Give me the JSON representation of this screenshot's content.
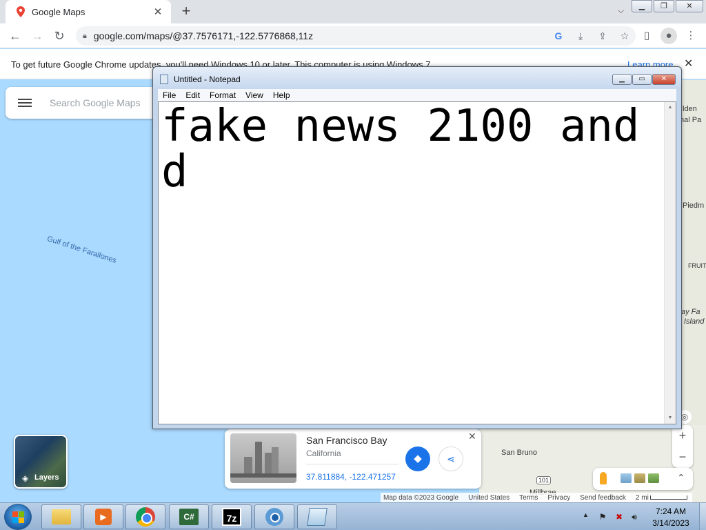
{
  "browser": {
    "tab_title": "Google Maps",
    "tab_close": "✕",
    "new_tab": "+",
    "url": "google.com/maps/@37.7576171,-122.5776868,11z",
    "infobar_message": "To get future Google Chrome updates, you'll need Windows 10 or later. This computer is using Windows 7.",
    "infobar_link": "Learn more",
    "infobar_close": "✕"
  },
  "maps": {
    "search_placeholder": "Search Google Maps",
    "gulf_label": "Gulf of the Farallones",
    "layers_label": "Layers",
    "right_labels": [
      "lden",
      "nal Pa",
      "Piedm",
      "FRUIT",
      "ay Fa",
      "Island"
    ],
    "san_bruno": "San Bruno",
    "millbrae": "Millbrae",
    "highway": "101",
    "place_card": {
      "name": "San Francisco Bay",
      "region": "California",
      "coords": "37.811884, -122.471257",
      "close": "✕"
    },
    "zoom_in": "+",
    "zoom_out": "−",
    "attribution": {
      "map_data": "Map data ©2023 Google",
      "country": "United States",
      "terms": "Terms",
      "privacy": "Privacy",
      "feedback": "Send feedback",
      "scale": "2 mi"
    }
  },
  "notepad": {
    "title": "Untitled - Notepad",
    "menus": [
      "File",
      "Edit",
      "Format",
      "View",
      "Help"
    ],
    "content": "fake news 2100 and d"
  },
  "taskbar": {
    "media_glyph": "▶",
    "cs_label": "C#",
    "sevenzip_label": "7z",
    "time": "7:24 AM",
    "date": "3/14/2023"
  },
  "colors": {
    "water": "#aadaff",
    "link": "#1a73e8",
    "notepad_frame": "#c4d6ec",
    "taskbar": "#95b3d4"
  },
  "icons": [
    "google-maps-favicon",
    "back-arrow-icon",
    "forward-arrow-icon",
    "reload-icon",
    "lock-icon",
    "google-lens-icon",
    "install-icon",
    "share-icon",
    "bookmark-star-icon",
    "side-panel-icon",
    "profile-icon",
    "kebab-menu-icon",
    "hamburger-menu-icon",
    "layers-icon",
    "directions-icon",
    "pegman-icon",
    "notepad-icon",
    "windows-start-icon",
    "folder-icon",
    "chrome-icon",
    "7zip-icon",
    "volume-icon",
    "network-icon"
  ]
}
